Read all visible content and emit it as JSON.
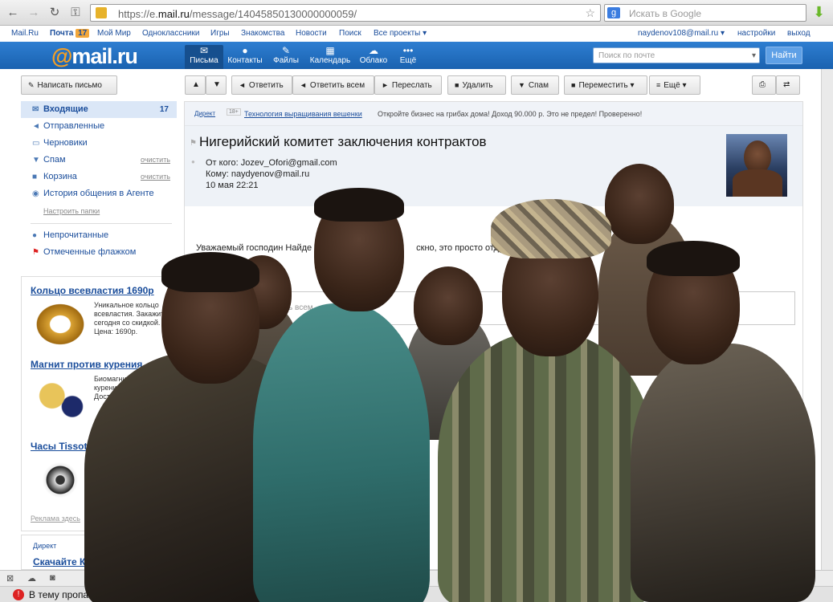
{
  "browser": {
    "url_prefix": "https://e.",
    "url_domain": "mail.ru",
    "url_rest": "/message/14045850130000000059/",
    "search_placeholder": "Искать в Google",
    "search_engine_badge": "g"
  },
  "portal": {
    "mailru": "Mail.Ru",
    "pochta": "Почта",
    "pochta_count": "17",
    "moy_mir": "Мой Мир",
    "odnoklassniki": "Одноклассники",
    "igry": "Игры",
    "znakomstva": "Знакомства",
    "novosti": "Новости",
    "poisk": "Поиск",
    "vse_proekty": "Все проекты ▾",
    "user": "naydenov108@mail.ru ▾",
    "settings": "настройки",
    "exit": "выход"
  },
  "header": {
    "logo_at": "@",
    "logo_text": "mail.ru",
    "tabs": [
      {
        "label": "Письма",
        "icon": "✉"
      },
      {
        "label": "Контакты",
        "icon": "👥"
      },
      {
        "label": "Файлы",
        "icon": "📎"
      },
      {
        "label": "Календарь",
        "icon": "▦"
      },
      {
        "label": "Облако",
        "icon": "☁"
      },
      {
        "label": "Ещё",
        "icon": "•••"
      }
    ],
    "search_placeholder": "Поиск по почте",
    "find_button": "Найти"
  },
  "toolbar": {
    "compose": "Написать письмо",
    "up": "▲",
    "down": "▼",
    "reply": "Ответить",
    "reply_all": "Ответить всем",
    "forward": "Переслать",
    "delete": "Удалить",
    "spam": "Спам",
    "move": "Переместить ▾",
    "more": "Ещё ▾"
  },
  "sidebar": {
    "items": [
      {
        "label": "Входящие",
        "count": "17"
      },
      {
        "label": "Отправленные"
      },
      {
        "label": "Черновики"
      },
      {
        "label": "Спам",
        "clear": "очистить"
      },
      {
        "label": "Корзина",
        "clear": "очистить"
      },
      {
        "label": "История общения в Агенте"
      }
    ],
    "configure": "Настроить папки",
    "filters": [
      {
        "label": "Непрочитанные"
      },
      {
        "label": "Отмеченные флажком"
      }
    ]
  },
  "ads": [
    {
      "title": "Кольцо всевластия 1690р",
      "text": "Уникальное кольцо всевластия. Закажите сегодня со скидкой. Цена: 1690р."
    },
    {
      "title": "Магнит против курения",
      "text": "Биомагниты от курения \"ZeroSmoke\" Доставка. Акция"
    },
    {
      "title": "Часы Tissot",
      "text": ""
    }
  ],
  "ads_footer": "Реклама здесь",
  "direct_box": {
    "label": "Директ",
    "title": "Скачайте КМ"
  },
  "message": {
    "ad_label": "Директ",
    "ad_age": "18+",
    "ad_link": "Технология выращивания вешенки",
    "ad_text": "Откройте бизнес на грибах дома! Доход 90.000 р. Это не предел! Проверенно!",
    "subject": "Нигерийский комитет заключения контрактов",
    "from": "От кого: Jozev_Ofori@gmail.com",
    "to": "Кому: naydyenov@mail.ru",
    "date": "10 мая 22:21",
    "greeting_start": "Уважаемый господин Найде",
    "greeting_end": "скно, это просто отдать",
    "reply_placeholder": "ь всем"
  },
  "status": {
    "text": "В тему пропа"
  },
  "colors": {
    "brand_blue": "#1a62b0",
    "brand_orange": "#f7a023",
    "link": "#1a4d9b"
  }
}
